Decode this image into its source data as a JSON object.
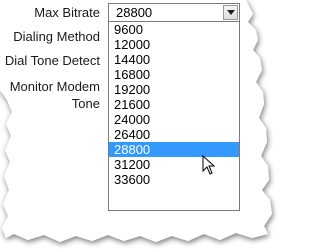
{
  "form": {
    "labels": {
      "max_bitrate": "Max Bitrate",
      "dialing_method": "Dialing Method",
      "dial_tone_detect": "Dial Tone Detect",
      "monitor_modem_line1": "Monitor Modem",
      "monitor_modem_line2": "Tone"
    },
    "max_bitrate_select": {
      "value": "28800",
      "options": [
        "9600",
        "12000",
        "14400",
        "16800",
        "19200",
        "21600",
        "24000",
        "26400",
        "28800",
        "31200",
        "33600"
      ],
      "highlighted": "28800"
    }
  },
  "colors": {
    "highlight": "#3399ff",
    "highlight_text": "#ffffff"
  },
  "icons": {
    "dropdown_arrow": "chevron-down-icon",
    "cursor": "mouse-pointer-icon"
  }
}
